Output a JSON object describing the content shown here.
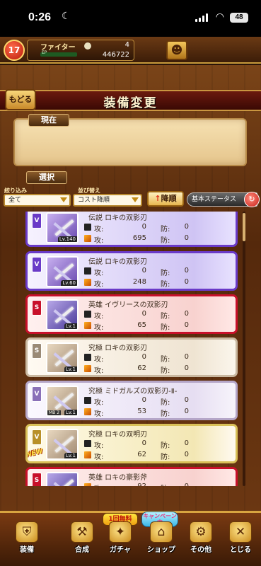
{
  "status_bar": {
    "time": "0:26",
    "battery": "48"
  },
  "player": {
    "level": "17",
    "class_name": "ファイター",
    "ep_label": "EP",
    "gems": "4",
    "money": "446722"
  },
  "header": {
    "back_label": "もどる",
    "title": "装備変更"
  },
  "current_label": "現在",
  "select_label": "選択",
  "filter": {
    "label": "絞り込み",
    "value": "全て"
  },
  "sort": {
    "label": "並び替え",
    "value": "コスト降順",
    "order_label": "降順",
    "order_arrow": "↑"
  },
  "stat_button": "基本ステータス",
  "items": [
    {
      "rank": "legend",
      "name": "伝説 ロキの双影刃",
      "level": "Lv.140",
      "atk1": "0",
      "def1": "0",
      "atk2": "695",
      "def2": "0",
      "new": false,
      "mb": ""
    },
    {
      "rank": "legend",
      "name": "伝説 ロキの双影刃",
      "level": "Lv.60",
      "atk1": "0",
      "def1": "0",
      "atk2": "248",
      "def2": "0",
      "new": false,
      "mb": ""
    },
    {
      "rank": "hero",
      "name": "英雄 イヴリースの双影刃",
      "level": "Lv.1",
      "atk1": "0",
      "def1": "0",
      "atk2": "65",
      "def2": "0",
      "new": false,
      "mb": ""
    },
    {
      "rank": "ultimate",
      "name": "究極 ロキの双影刃",
      "level": "Lv.1",
      "atk1": "0",
      "def1": "0",
      "atk2": "62",
      "def2": "0",
      "new": false,
      "mb": ""
    },
    {
      "rank": "ultimate-lav",
      "name": "究極 ミドガルズの双影刃-Ⅱ-",
      "level": "Lv.1",
      "atk1": "0",
      "def1": "0",
      "atk2": "53",
      "def2": "0",
      "new": false,
      "mb": "MB 2"
    },
    {
      "rank": "ultimate-gold",
      "name": "究極 ロキの双明刃",
      "level": "Lv.1",
      "atk1": "0",
      "def1": "0",
      "atk2": "62",
      "def2": "0",
      "new": true,
      "mb": ""
    },
    {
      "rank": "hero",
      "name": "英雄 ロキの豪影斧",
      "level": "",
      "atk1": "92",
      "def1": "0",
      "atk2": "",
      "def2": "",
      "new": true,
      "mb": ""
    }
  ],
  "stat_labels": {
    "atk": "攻:",
    "def": "防:"
  },
  "new_label": "NEW",
  "nav": [
    {
      "label": "装備",
      "icon": "armor-icon"
    },
    {
      "label": "合成",
      "icon": "hammer-icon"
    },
    {
      "label": "ガチャ",
      "icon": "gacha-icon"
    },
    {
      "label": "ショップ",
      "icon": "shop-icon"
    },
    {
      "label": "その他",
      "icon": "gear-icon"
    },
    {
      "label": "とじる",
      "icon": "close-icon"
    }
  ],
  "campaign": {
    "free_once": "1回無料",
    "campaign": "キャンペーン中"
  }
}
